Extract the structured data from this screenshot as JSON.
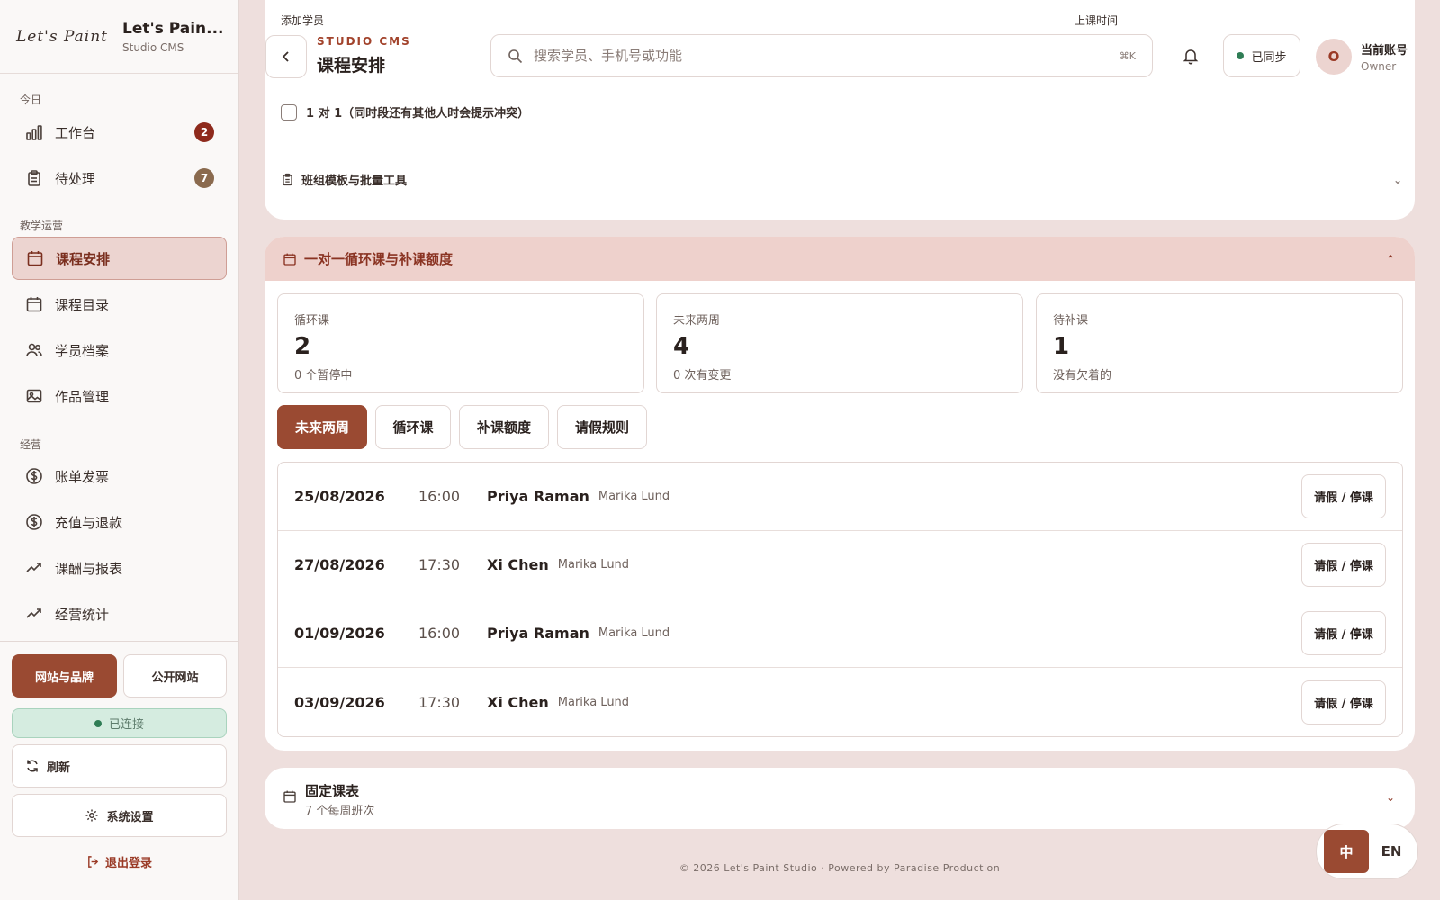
{
  "brand": {
    "logo": "Let's Paint",
    "title": "Let's Pain...",
    "subtitle": "Studio CMS"
  },
  "sidebar": {
    "sections": [
      "今日",
      "教学运营",
      "经营"
    ],
    "items": [
      {
        "label": "工作台",
        "icon": "bar-chart-icon",
        "badge": "2"
      },
      {
        "label": "待处理",
        "icon": "clipboard-icon",
        "badge": "7"
      },
      {
        "label": "课程安排",
        "icon": "calendar-icon",
        "active": true
      },
      {
        "label": "课程目录",
        "icon": "calendar-icon"
      },
      {
        "label": "学员档案",
        "icon": "users-icon"
      },
      {
        "label": "作品管理",
        "icon": "image-icon"
      },
      {
        "label": "账单发票",
        "icon": "dollar-icon"
      },
      {
        "label": "充值与退款",
        "icon": "dollar-icon"
      },
      {
        "label": "课酬与报表",
        "icon": "trend-icon"
      },
      {
        "label": "经营统计",
        "icon": "trend-icon"
      }
    ],
    "brand_button": "网站与品牌",
    "public_button": "公开网站",
    "connection_status": "已连接",
    "refresh": "刷新",
    "settings": "系统设置",
    "logout": "退出登录"
  },
  "topbar": {
    "kicker": "STUDIO CMS",
    "title": "课程安排",
    "search_placeholder": "搜索学员、手机号或功能",
    "shortcut": "⌘K",
    "sync_status": "已同步",
    "account_initial": "O",
    "account_name": "当前账号",
    "account_role": "Owner"
  },
  "form": {
    "label_add_student": "添加学员",
    "label_class_time": "上课时间",
    "one_on_one": "1 对 1（同时段还有其他人时会提示冲突）",
    "template_tools": "班组模板与批量工具"
  },
  "recurring": {
    "title": "一对一循环课与补课额度",
    "stats": [
      {
        "label": "循环课",
        "value": "2",
        "sub": "0 个暂停中"
      },
      {
        "label": "未来两周",
        "value": "4",
        "sub": "0 次有变更"
      },
      {
        "label": "待补课",
        "value": "1",
        "sub": "没有欠着的"
      }
    ],
    "tabs": [
      "未来两周",
      "循环课",
      "补课额度",
      "请假规则"
    ],
    "rows": [
      {
        "date": "25/08/2026",
        "time": "16:00",
        "student": "Priya Raman",
        "teacher": "Marika Lund",
        "action": "请假 / 停课"
      },
      {
        "date": "27/08/2026",
        "time": "17:30",
        "student": "Xi Chen",
        "teacher": "Marika Lund",
        "action": "请假 / 停课"
      },
      {
        "date": "01/09/2026",
        "time": "16:00",
        "student": "Priya Raman",
        "teacher": "Marika Lund",
        "action": "请假 / 停课"
      },
      {
        "date": "03/09/2026",
        "time": "17:30",
        "student": "Xi Chen",
        "teacher": "Marika Lund",
        "action": "请假 / 停课"
      }
    ]
  },
  "fixed_schedule": {
    "title": "固定课表",
    "subtitle": "7 个每周班次"
  },
  "footer": "© 2026 Let's Paint Studio · Powered by Paradise Production",
  "language": {
    "zh": "中",
    "en": "EN"
  },
  "colors": {
    "accent": "#9a4a32",
    "active_bg": "#ecd4d0",
    "section_bg": "#eed1cc",
    "success": "#2f7d55"
  }
}
